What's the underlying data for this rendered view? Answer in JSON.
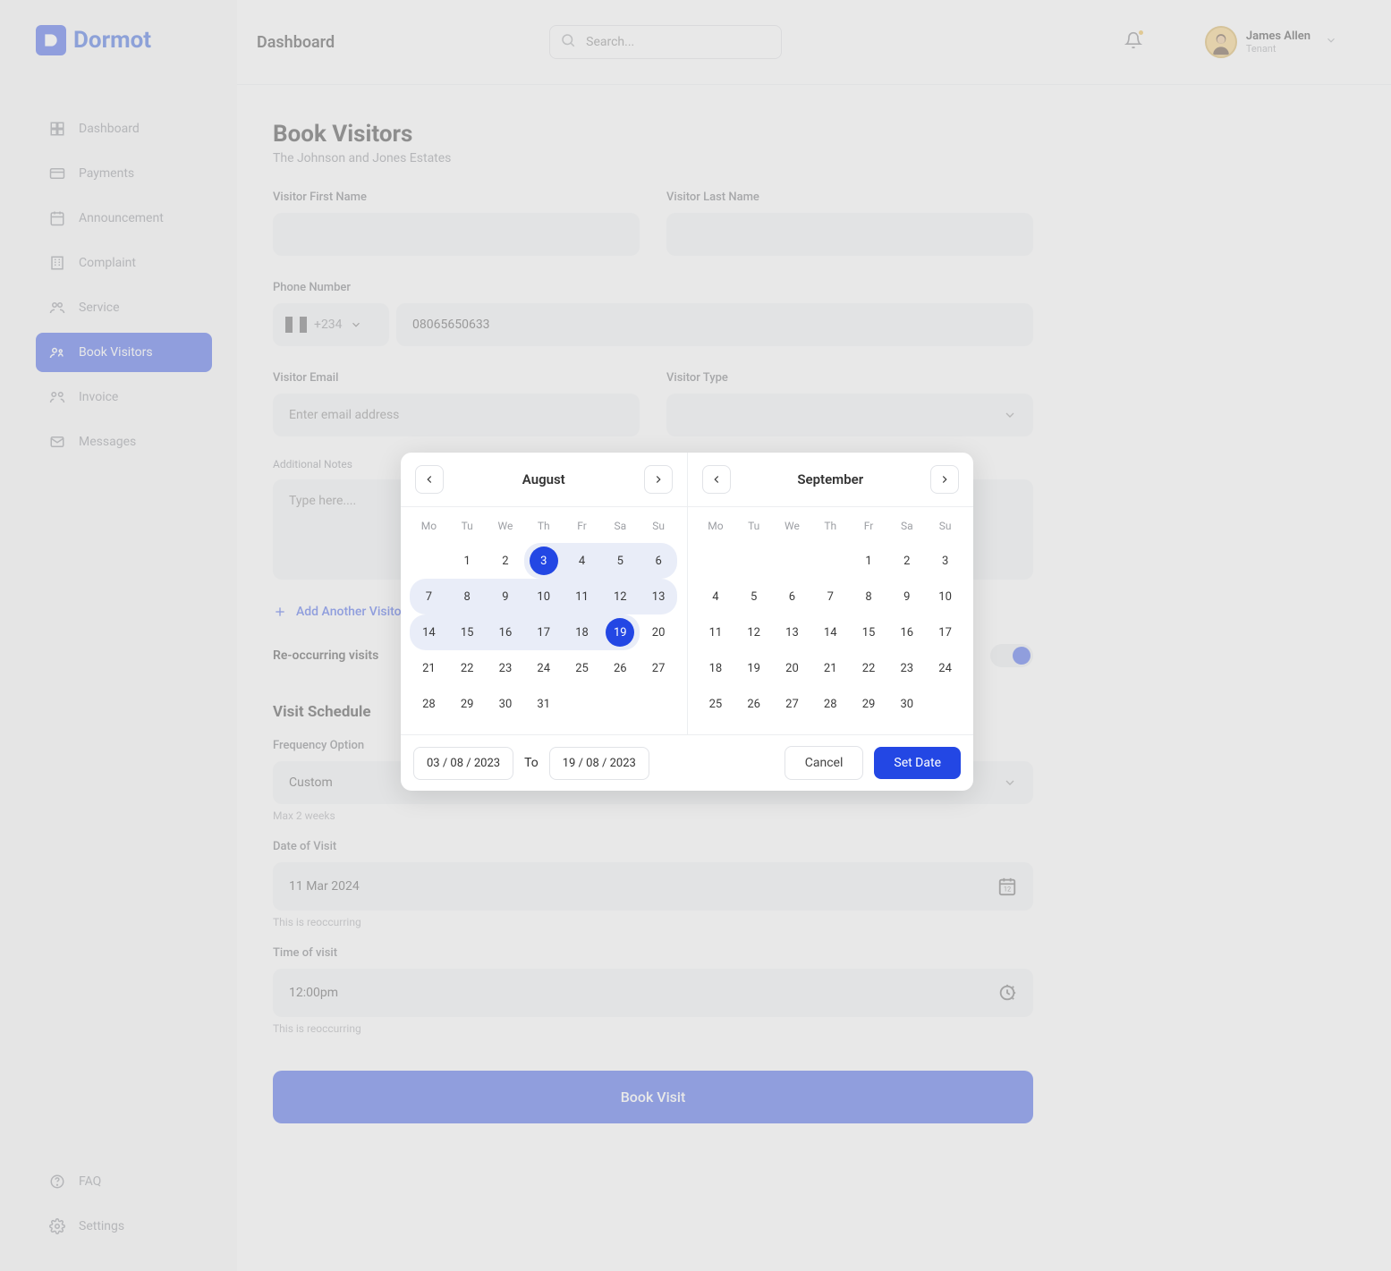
{
  "brand": "Dormot",
  "header": {
    "title": "Dashboard",
    "search_placeholder": "Search..."
  },
  "user": {
    "name": "James Allen",
    "role": "Tenant"
  },
  "sidebar": {
    "items": [
      {
        "label": "Dashboard"
      },
      {
        "label": "Payments"
      },
      {
        "label": "Announcement"
      },
      {
        "label": "Complaint"
      },
      {
        "label": "Service"
      },
      {
        "label": "Book Visitors"
      },
      {
        "label": "Invoice"
      },
      {
        "label": "Messages"
      }
    ],
    "bottom": [
      {
        "label": "FAQ"
      },
      {
        "label": "Settings"
      }
    ]
  },
  "page": {
    "heading": "Book Visitors",
    "subtitle": "The Johnson and Jones Estates",
    "labels": {
      "first_name": "Visitor First Name",
      "last_name": "Visitor Last Name",
      "phone": "Phone Number",
      "email": "Visitor Email",
      "type": "Visitor Type",
      "notes": "Additional Notes"
    },
    "phone_cc": "+234",
    "phone_value": "08065650633",
    "email_placeholder": "Enter email address",
    "notes_placeholder": "Type here....",
    "add_another": "Add Another Visitor",
    "reoccurring_label": "Re-occurring visits",
    "schedule_heading": "Visit Schedule",
    "frequency_label": "Frequency Option",
    "frequency_value": "Custom",
    "frequency_helper": "Max 2 weeks",
    "date_label": "Date of Visit",
    "date_value": "11 Mar 2024",
    "date_helper": "This is reoccurring",
    "time_label": "Time of visit",
    "time_value": "12:00pm",
    "time_helper": "This is reoccurring",
    "book_button": "Book Visit"
  },
  "datepicker": {
    "months": {
      "left": {
        "name": "August",
        "days_of_week": [
          "Mo",
          "Tu",
          "We",
          "Th",
          "Fr",
          "Sa",
          "Su"
        ],
        "leading_blanks": 1,
        "days_in_month": 31
      },
      "right": {
        "name": "September",
        "days_of_week": [
          "Mo",
          "Tu",
          "We",
          "Th",
          "Fr",
          "Sa",
          "Su"
        ],
        "leading_blanks": 4,
        "days_in_month": 30
      }
    },
    "selected_start": 3,
    "selected_end": 19,
    "from_value": "03 / 08 / 2023",
    "to_label": "To",
    "to_value": "19 / 08 / 2023",
    "cancel": "Cancel",
    "set": "Set Date"
  }
}
